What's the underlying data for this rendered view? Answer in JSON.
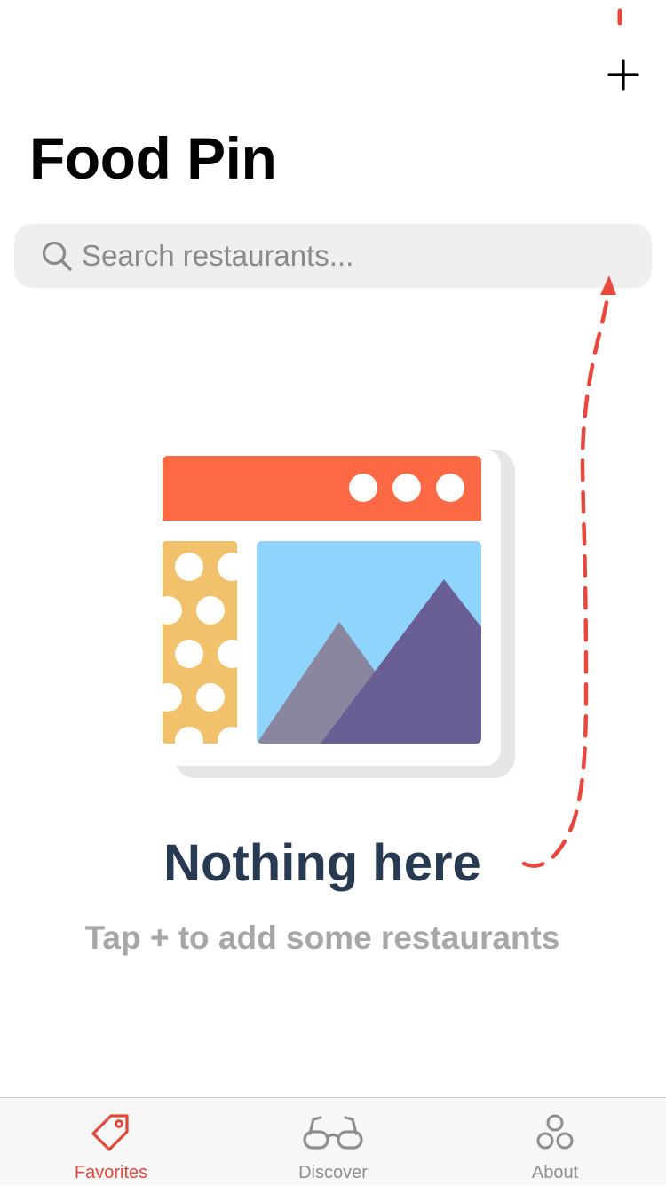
{
  "nav": {
    "title": "Food Pin",
    "add_icon": "plus-icon"
  },
  "search": {
    "placeholder": "Search restaurants...",
    "value": "",
    "icon": "search-icon"
  },
  "empty_state": {
    "illustration": "browser-window-illustration",
    "title": "Nothing here",
    "subtitle": "Tap +  to add some restaurants"
  },
  "tab_bar": {
    "tabs": [
      {
        "label": "Favorites",
        "icon": "tag-icon",
        "active": true
      },
      {
        "label": "Discover",
        "icon": "glasses-icon",
        "active": false
      },
      {
        "label": "About",
        "icon": "three-circles-icon",
        "active": false
      }
    ]
  },
  "colors": {
    "accent": "#e2473b",
    "hint_arrow": "#e8473b",
    "title_dark": "#283a52",
    "subtitle_gray": "#a7a7a7",
    "illustration_header": "#fd6845",
    "illustration_sky": "#8ed4fc",
    "illustration_panel": "#f2c16c",
    "illustration_mountain_front": "#6a5f95",
    "illustration_mountain_back": "#8a86a0"
  }
}
